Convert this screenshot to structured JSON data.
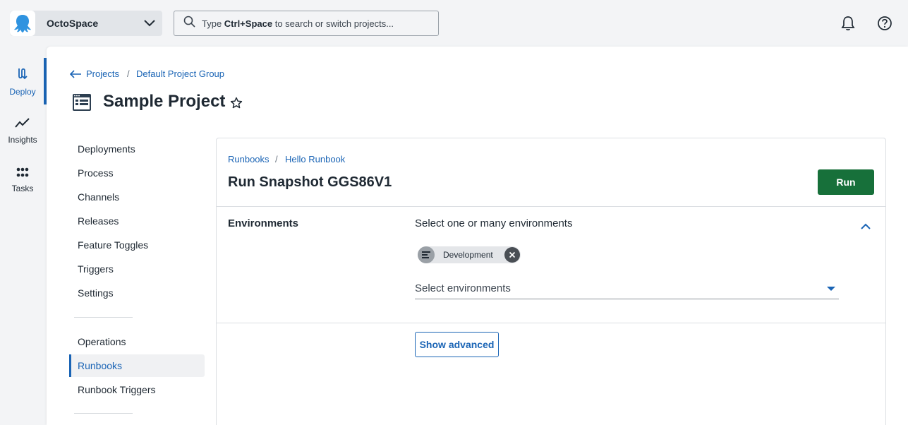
{
  "topbar": {
    "space_name": "OctoSpace",
    "search_prefix": "Type ",
    "search_shortcut": "Ctrl+Space",
    "search_suffix": " to search or switch projects..."
  },
  "leftnav": {
    "items": [
      {
        "label": "Deploy",
        "icon": "deploy-icon",
        "active": true
      },
      {
        "label": "Insights",
        "icon": "insights-icon",
        "active": false
      },
      {
        "label": "Tasks",
        "icon": "tasks-icon",
        "active": false
      }
    ]
  },
  "breadcrumb": {
    "projects": "Projects",
    "separator": "/",
    "group": "Default Project Group"
  },
  "project": {
    "title": "Sample Project"
  },
  "subnav": {
    "items": [
      "Deployments",
      "Process",
      "Channels",
      "Releases",
      "Feature Toggles",
      "Triggers",
      "Settings"
    ],
    "ops_items": [
      "Operations",
      "Runbooks",
      "Runbook Triggers"
    ],
    "active": "Runbooks"
  },
  "runbook": {
    "crumb_runbooks": "Runbooks",
    "crumb_separator": "/",
    "crumb_name": "Hello Runbook",
    "title": "Run Snapshot GGS86V1",
    "run_label": "Run",
    "environments_label": "Environments",
    "environments_heading": "Select one or many environments",
    "selected_env": "Development",
    "select_placeholder": "Select environments",
    "advanced_label": "Show advanced"
  },
  "colors": {
    "accent": "#1a64b5",
    "run_button": "#17703a",
    "background": "#f3f4f6"
  }
}
